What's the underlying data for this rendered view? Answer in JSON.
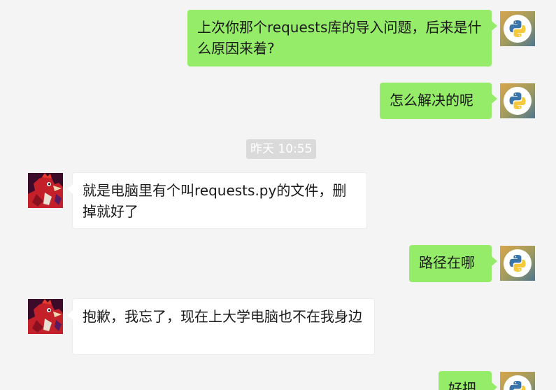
{
  "chat": {
    "messages": [
      {
        "side": "mine",
        "text": "上次你那个requests库的导入问题，后来是什么原因来着?"
      },
      {
        "side": "mine",
        "text": "怎么解决的呢"
      },
      {
        "side": "theirs",
        "text": "就是电脑里有个叫requests.py的文件，删掉就好了"
      },
      {
        "side": "mine",
        "text": "路径在哪"
      },
      {
        "side": "theirs",
        "text": "抱歉，我忘了，现在上大学电脑也不在我身边"
      },
      {
        "side": "mine",
        "text": "好把"
      }
    ],
    "timestamp": "昨天 10:55"
  },
  "avatars": {
    "self_icon": "python-logo-icon",
    "other_icon": "red-rooster-illustration-icon"
  },
  "colors": {
    "background": "#f4f4f4",
    "my_bubble": "#95ec69",
    "their_bubble": "#ffffff",
    "timestamp_bg": "#dadada"
  }
}
